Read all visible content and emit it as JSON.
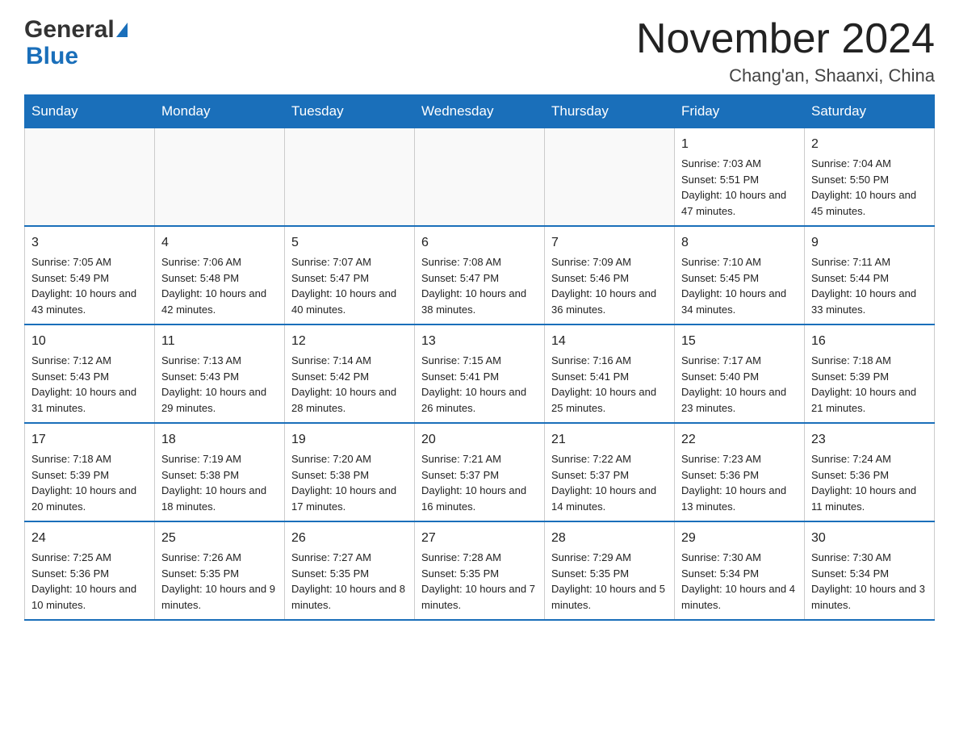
{
  "logo": {
    "line1": "General",
    "line2": "Blue"
  },
  "title": "November 2024",
  "subtitle": "Chang'an, Shaanxi, China",
  "weekdays": [
    "Sunday",
    "Monday",
    "Tuesday",
    "Wednesday",
    "Thursday",
    "Friday",
    "Saturday"
  ],
  "weeks": [
    [
      {
        "day": "",
        "info": ""
      },
      {
        "day": "",
        "info": ""
      },
      {
        "day": "",
        "info": ""
      },
      {
        "day": "",
        "info": ""
      },
      {
        "day": "",
        "info": ""
      },
      {
        "day": "1",
        "info": "Sunrise: 7:03 AM\nSunset: 5:51 PM\nDaylight: 10 hours and 47 minutes."
      },
      {
        "day": "2",
        "info": "Sunrise: 7:04 AM\nSunset: 5:50 PM\nDaylight: 10 hours and 45 minutes."
      }
    ],
    [
      {
        "day": "3",
        "info": "Sunrise: 7:05 AM\nSunset: 5:49 PM\nDaylight: 10 hours and 43 minutes."
      },
      {
        "day": "4",
        "info": "Sunrise: 7:06 AM\nSunset: 5:48 PM\nDaylight: 10 hours and 42 minutes."
      },
      {
        "day": "5",
        "info": "Sunrise: 7:07 AM\nSunset: 5:47 PM\nDaylight: 10 hours and 40 minutes."
      },
      {
        "day": "6",
        "info": "Sunrise: 7:08 AM\nSunset: 5:47 PM\nDaylight: 10 hours and 38 minutes."
      },
      {
        "day": "7",
        "info": "Sunrise: 7:09 AM\nSunset: 5:46 PM\nDaylight: 10 hours and 36 minutes."
      },
      {
        "day": "8",
        "info": "Sunrise: 7:10 AM\nSunset: 5:45 PM\nDaylight: 10 hours and 34 minutes."
      },
      {
        "day": "9",
        "info": "Sunrise: 7:11 AM\nSunset: 5:44 PM\nDaylight: 10 hours and 33 minutes."
      }
    ],
    [
      {
        "day": "10",
        "info": "Sunrise: 7:12 AM\nSunset: 5:43 PM\nDaylight: 10 hours and 31 minutes."
      },
      {
        "day": "11",
        "info": "Sunrise: 7:13 AM\nSunset: 5:43 PM\nDaylight: 10 hours and 29 minutes."
      },
      {
        "day": "12",
        "info": "Sunrise: 7:14 AM\nSunset: 5:42 PM\nDaylight: 10 hours and 28 minutes."
      },
      {
        "day": "13",
        "info": "Sunrise: 7:15 AM\nSunset: 5:41 PM\nDaylight: 10 hours and 26 minutes."
      },
      {
        "day": "14",
        "info": "Sunrise: 7:16 AM\nSunset: 5:41 PM\nDaylight: 10 hours and 25 minutes."
      },
      {
        "day": "15",
        "info": "Sunrise: 7:17 AM\nSunset: 5:40 PM\nDaylight: 10 hours and 23 minutes."
      },
      {
        "day": "16",
        "info": "Sunrise: 7:18 AM\nSunset: 5:39 PM\nDaylight: 10 hours and 21 minutes."
      }
    ],
    [
      {
        "day": "17",
        "info": "Sunrise: 7:18 AM\nSunset: 5:39 PM\nDaylight: 10 hours and 20 minutes."
      },
      {
        "day": "18",
        "info": "Sunrise: 7:19 AM\nSunset: 5:38 PM\nDaylight: 10 hours and 18 minutes."
      },
      {
        "day": "19",
        "info": "Sunrise: 7:20 AM\nSunset: 5:38 PM\nDaylight: 10 hours and 17 minutes."
      },
      {
        "day": "20",
        "info": "Sunrise: 7:21 AM\nSunset: 5:37 PM\nDaylight: 10 hours and 16 minutes."
      },
      {
        "day": "21",
        "info": "Sunrise: 7:22 AM\nSunset: 5:37 PM\nDaylight: 10 hours and 14 minutes."
      },
      {
        "day": "22",
        "info": "Sunrise: 7:23 AM\nSunset: 5:36 PM\nDaylight: 10 hours and 13 minutes."
      },
      {
        "day": "23",
        "info": "Sunrise: 7:24 AM\nSunset: 5:36 PM\nDaylight: 10 hours and 11 minutes."
      }
    ],
    [
      {
        "day": "24",
        "info": "Sunrise: 7:25 AM\nSunset: 5:36 PM\nDaylight: 10 hours and 10 minutes."
      },
      {
        "day": "25",
        "info": "Sunrise: 7:26 AM\nSunset: 5:35 PM\nDaylight: 10 hours and 9 minutes."
      },
      {
        "day": "26",
        "info": "Sunrise: 7:27 AM\nSunset: 5:35 PM\nDaylight: 10 hours and 8 minutes."
      },
      {
        "day": "27",
        "info": "Sunrise: 7:28 AM\nSunset: 5:35 PM\nDaylight: 10 hours and 7 minutes."
      },
      {
        "day": "28",
        "info": "Sunrise: 7:29 AM\nSunset: 5:35 PM\nDaylight: 10 hours and 5 minutes."
      },
      {
        "day": "29",
        "info": "Sunrise: 7:30 AM\nSunset: 5:34 PM\nDaylight: 10 hours and 4 minutes."
      },
      {
        "day": "30",
        "info": "Sunrise: 7:30 AM\nSunset: 5:34 PM\nDaylight: 10 hours and 3 minutes."
      }
    ]
  ]
}
